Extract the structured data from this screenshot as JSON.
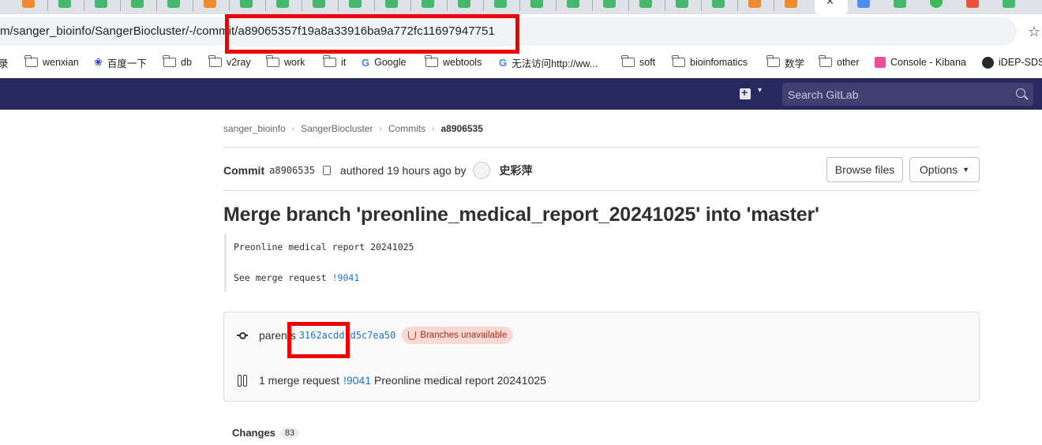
{
  "browser": {
    "url": "m/sanger_bioinfo/SangerBiocluster/-/commit/a89065357f19a8a33916ba9a772fc11697947751",
    "bookmarks": [
      {
        "label": "录",
        "icon": "none"
      },
      {
        "label": "wenxian",
        "icon": "folder-icon"
      },
      {
        "label": "百度一下",
        "icon": "baidu-paw-icon"
      },
      {
        "label": "db",
        "icon": "folder-icon"
      },
      {
        "label": "v2ray",
        "icon": "folder-icon"
      },
      {
        "label": "work",
        "icon": "folder-icon"
      },
      {
        "label": "it",
        "icon": "folder-icon"
      },
      {
        "label": "Google",
        "icon": "google-icon"
      },
      {
        "label": "webtools",
        "icon": "folder-icon"
      },
      {
        "label": "无法访问http://ww...",
        "icon": "google-icon"
      },
      {
        "label": "soft",
        "icon": "folder-icon"
      },
      {
        "label": "bioinfomatics",
        "icon": "folder-icon"
      },
      {
        "label": "数学",
        "icon": "folder-icon"
      },
      {
        "label": "other",
        "icon": "folder-icon"
      },
      {
        "label": "Console - Kibana",
        "icon": "kibana-icon"
      },
      {
        "label": "iDEP-SDS",
        "icon": "github-icon"
      }
    ]
  },
  "gitlab": {
    "search_placeholder": "Search GitLab",
    "breadcrumb": [
      "sanger_bioinfo",
      "SangerBiocluster",
      "Commits",
      "a8906535"
    ],
    "commit": {
      "label": "Commit",
      "short_sha": "a8906535",
      "authored_text": "authored 19 hours ago by",
      "author": "史彩萍",
      "browse_files": "Browse files",
      "options": "Options"
    },
    "title": "Merge branch 'preonline_medical_report_20241025' into 'master'",
    "description": {
      "line1": "Preonline medical report 20241025",
      "line2_prefix": "See merge request ",
      "line2_link": "!9041"
    },
    "parents": {
      "label": "parents",
      "sha1": "3162acdd",
      "sha2": "d5c7ea50",
      "badge": "Branches unavailable"
    },
    "merge_request": {
      "prefix": "1 merge request",
      "link": "!9041",
      "title": "Preonline medical report 20241025"
    },
    "changes": {
      "label": "Changes",
      "count": "83"
    }
  },
  "colors": {
    "header_bg": "#292961",
    "link": "#1f75cb",
    "highlight": "#ee0000",
    "badge_bg": "#fcd8d3"
  }
}
